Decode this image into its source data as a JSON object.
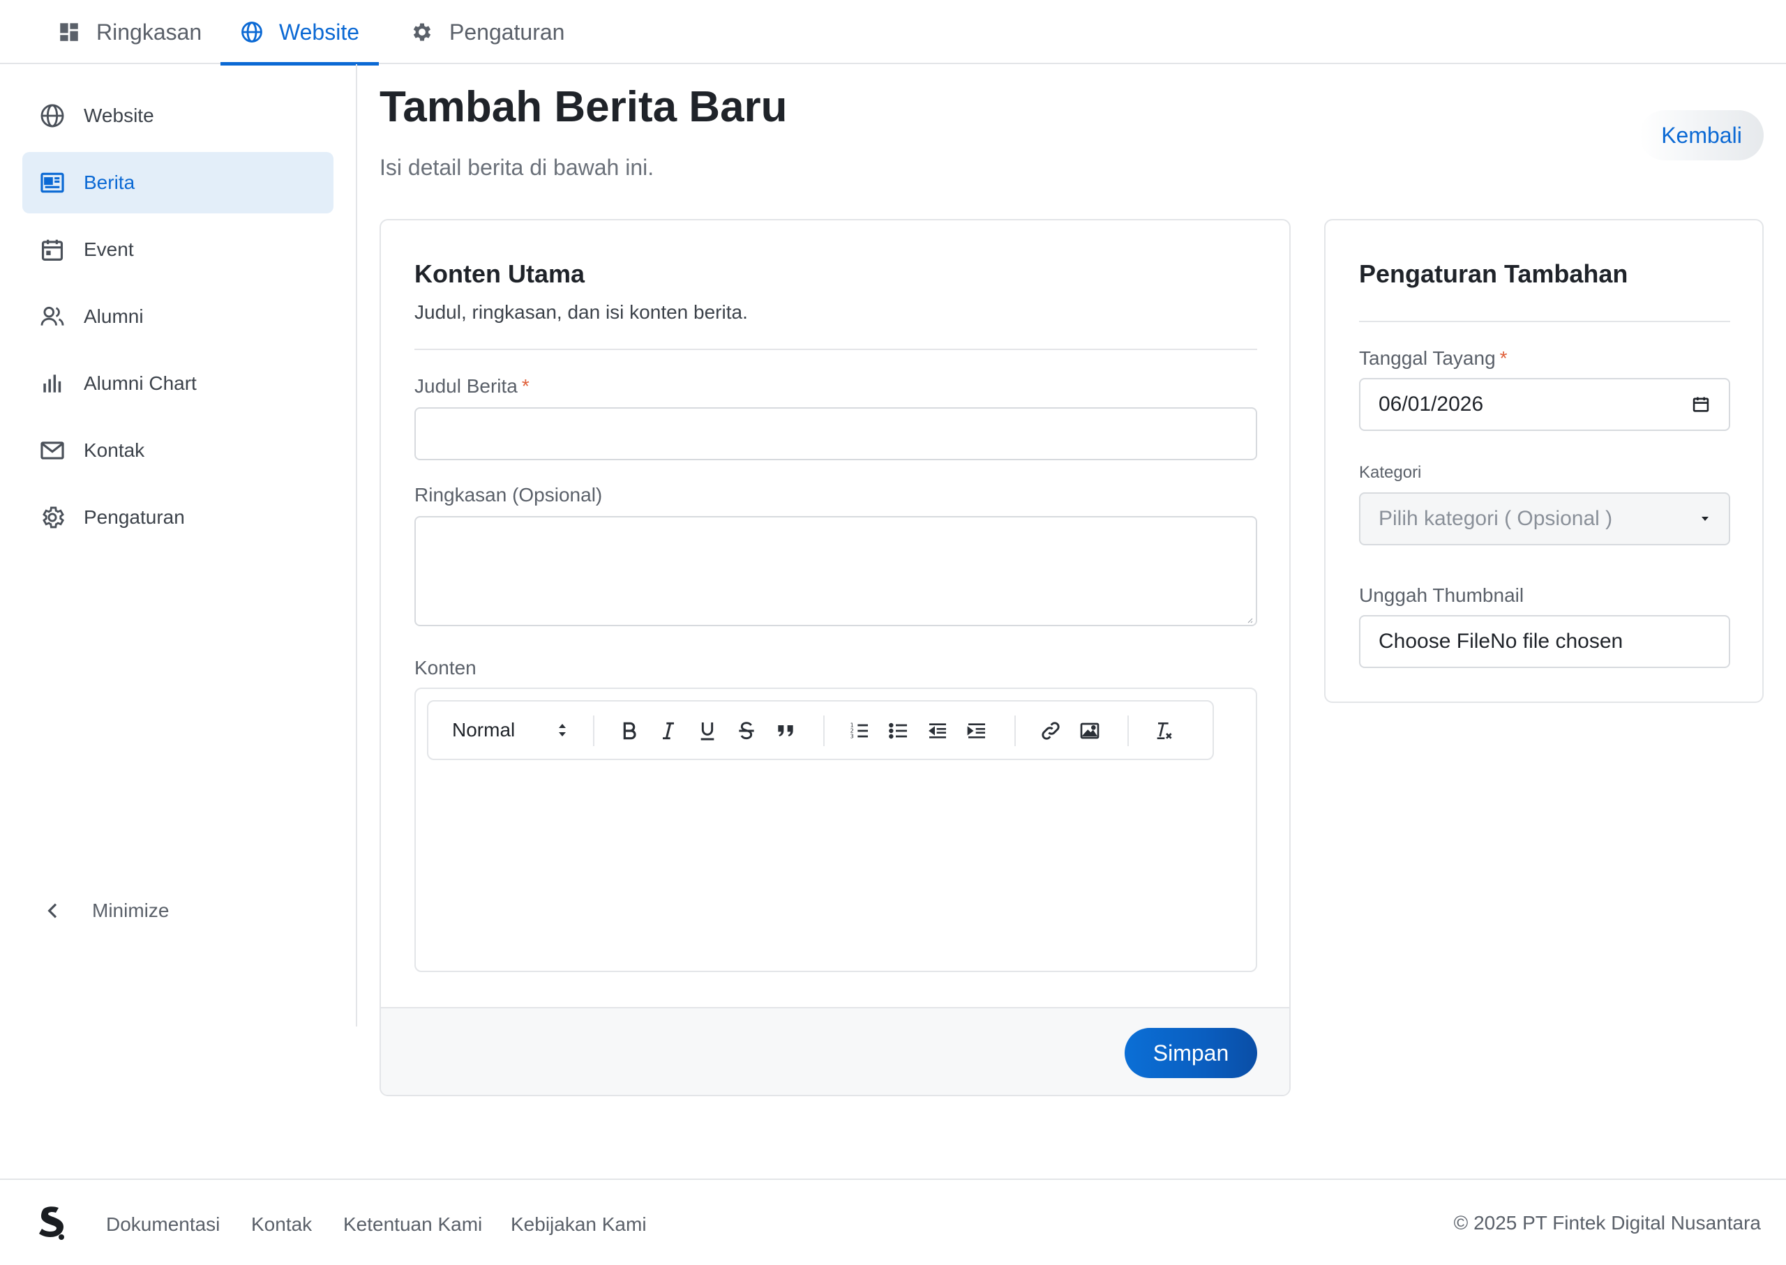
{
  "top_tabs": [
    {
      "label": "Ringkasan",
      "icon": "dashboard-icon",
      "active": false
    },
    {
      "label": "Website",
      "icon": "globe-icon",
      "active": true
    },
    {
      "label": "Pengaturan",
      "icon": "gear-icon",
      "active": false
    }
  ],
  "sidebar": {
    "items": [
      {
        "label": "Website",
        "icon": "globe-icon"
      },
      {
        "label": "Berita",
        "icon": "newspaper-icon",
        "active": true
      },
      {
        "label": "Event",
        "icon": "calendar-icon"
      },
      {
        "label": "Alumni",
        "icon": "users-icon"
      },
      {
        "label": "Alumni Chart",
        "icon": "bar-chart-icon"
      },
      {
        "label": "Kontak",
        "icon": "mail-icon"
      },
      {
        "label": "Pengaturan",
        "icon": "gear-icon"
      }
    ],
    "minimize_label": "Minimize"
  },
  "header": {
    "title": "Tambah Berita Baru",
    "subtitle": "Isi detail berita di bawah ini.",
    "back_label": "Kembali"
  },
  "main_card": {
    "title": "Konten Utama",
    "description": "Judul, ringkasan, dan isi konten berita.",
    "title_field": {
      "label": "Judul Berita",
      "required_mark": "*",
      "value": ""
    },
    "summary_field": {
      "label": "Ringkasan (Opsional)",
      "value": ""
    },
    "content_field": {
      "label": "Konten"
    },
    "editor": {
      "format_select": "Normal",
      "tools": [
        "bold-icon",
        "italic-icon",
        "underline-icon",
        "strikethrough-icon",
        "blockquote-icon",
        "ordered-list-icon",
        "bullet-list-icon",
        "outdent-icon",
        "indent-icon",
        "link-icon",
        "image-icon",
        "clear-format-icon"
      ]
    },
    "save_label": "Simpan"
  },
  "side_card": {
    "title": "Pengaturan Tambahan",
    "date_field": {
      "label": "Tanggal Tayang",
      "required_mark": "*",
      "value": "06/01/2026"
    },
    "category_field": {
      "label": "Kategori",
      "placeholder": "Pilih kategori ( Opsional )"
    },
    "thumbnail_field": {
      "label": "Unggah Thumbnail",
      "value": "Choose FileNo file chosen"
    }
  },
  "footer": {
    "links": [
      "Dokumentasi",
      "Kontak",
      "Ketentuan Kami",
      "Kebijakan Kami"
    ],
    "copyright": "© 2025 PT Fintek Digital Nusantara"
  },
  "colors": {
    "accent": "#0b69d4",
    "active_bg": "#e3eef9",
    "border": "#e3e5e8",
    "required": "#e0603a"
  }
}
